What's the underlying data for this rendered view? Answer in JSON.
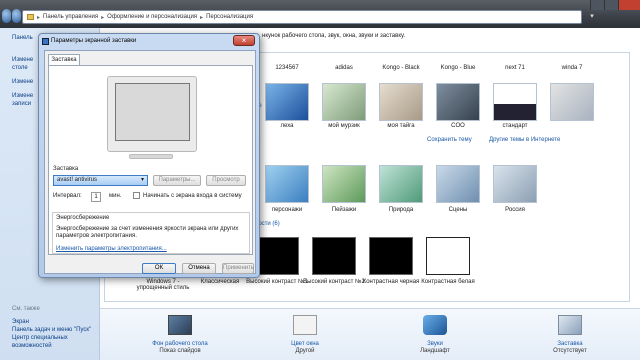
{
  "breadcrumb": {
    "item1": "Панель управления",
    "item2": "Оформление и персонализация",
    "item3": "Персонализация",
    "separator": "▸"
  },
  "leftnav": {
    "items": [
      "Панель",
      "Измене",
      "столе",
      "Измене",
      "Измене",
      "записи"
    ],
    "see_also_header": "См. также",
    "see_also": [
      "Экран",
      "Панель задач и меню \"Пуск\"",
      "Центр специальных",
      "возможностей"
    ]
  },
  "themes": {
    "partial_header": "нкунок рабочего стола, звук, окна, звуки и заставку.",
    "row1_captions": [
      "1234567",
      "adidas",
      "Kongo - Black",
      "Kongo - Blue",
      "next 71",
      "winda 7"
    ],
    "row2_captions": [
      "леха",
      "мой мурзик",
      "моя тайга",
      "COO",
      "стандарт"
    ],
    "row2_links": [
      "Сохранить тему",
      "Другие темы в Интернете"
    ],
    "row3_captions": [
      "персонажи",
      "Пейзажи",
      "Природа",
      "Сцены",
      "Россия"
    ],
    "hc_group_link": "ности (6)",
    "row4_captions": [
      "Windows 7 - упрощенный стиль",
      "Классическая",
      "Высокий контраст №1",
      "Высокий контраст №2",
      "Контрастная черная",
      "Контрастная белая"
    ],
    "partial_label": "ре"
  },
  "bottom": {
    "desktop_bg": {
      "label": "Фон рабочего стола",
      "value": "Показ слайдов"
    },
    "window_color": {
      "label": "Цвет окна",
      "value": "Другой"
    },
    "sounds": {
      "label": "Звуки",
      "value": "Ландшафт"
    },
    "screensaver": {
      "label": "Заставка",
      "value": "Отсутствует"
    }
  },
  "dialog": {
    "title": "Параметры экранной заставки",
    "tab": "Заставка",
    "screensaver_label": "Заставка",
    "screensaver_value": "avast! antivirus",
    "params_button": "Параметры...",
    "preview_button": "Просмотр",
    "interval_label": "Интервал:",
    "interval_value": "1",
    "interval_unit": "мин.",
    "logon_checkbox": "Начинать с экрана входа в систему",
    "energy_header": "Энергосбережение",
    "energy_desc": "Энергосбережение за счет изменения яркости экрана или других параметров электропитания.",
    "energy_link": "Изменить параметры электропитания...",
    "ok": "ОК",
    "cancel": "Отмена",
    "apply": "Применить"
  }
}
